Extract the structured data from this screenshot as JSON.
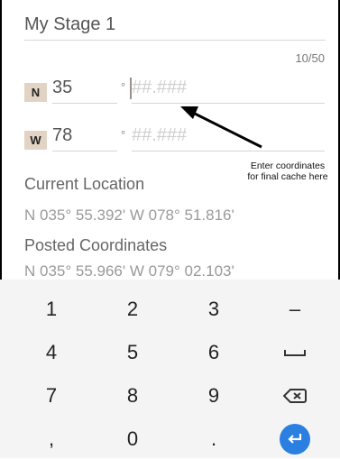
{
  "form": {
    "title_value": "My Stage 1",
    "title_counter": "10/50",
    "lat_dir": "N",
    "lat_degrees": "35",
    "lat_minutes_placeholder": "##.###",
    "lon_dir": "W",
    "lon_degrees": "78",
    "lon_minutes_placeholder": "##.###",
    "degree_symbol": "°"
  },
  "annotation": {
    "text_line1": "Enter coordinates",
    "text_line2": "for final cache here"
  },
  "current_location": {
    "label": "Current Location",
    "value": "N 035° 55.392'  W 078° 51.816'"
  },
  "posted_coordinates": {
    "label": "Posted Coordinates",
    "value": "N 035° 55.966'  W 079° 02.103'"
  },
  "keyboard": {
    "rows": [
      [
        "1",
        "2",
        "3",
        "–"
      ],
      [
        "4",
        "5",
        "6",
        "space"
      ],
      [
        "7",
        "8",
        "9",
        "backspace"
      ],
      [
        ",",
        "0",
        ".",
        "enter"
      ]
    ],
    "labels": {
      "k1": "1",
      "k2": "2",
      "k3": "3",
      "minus": "–",
      "k4": "4",
      "k5": "5",
      "k6": "6",
      "k7": "7",
      "k8": "8",
      "k9": "9",
      "comma": ",",
      "k0": "0",
      "period": "."
    }
  },
  "colors": {
    "badge_bg": "#e2d4c4",
    "enter_bg": "#2a7fe0",
    "keyboard_bg": "#f4f4f4"
  }
}
